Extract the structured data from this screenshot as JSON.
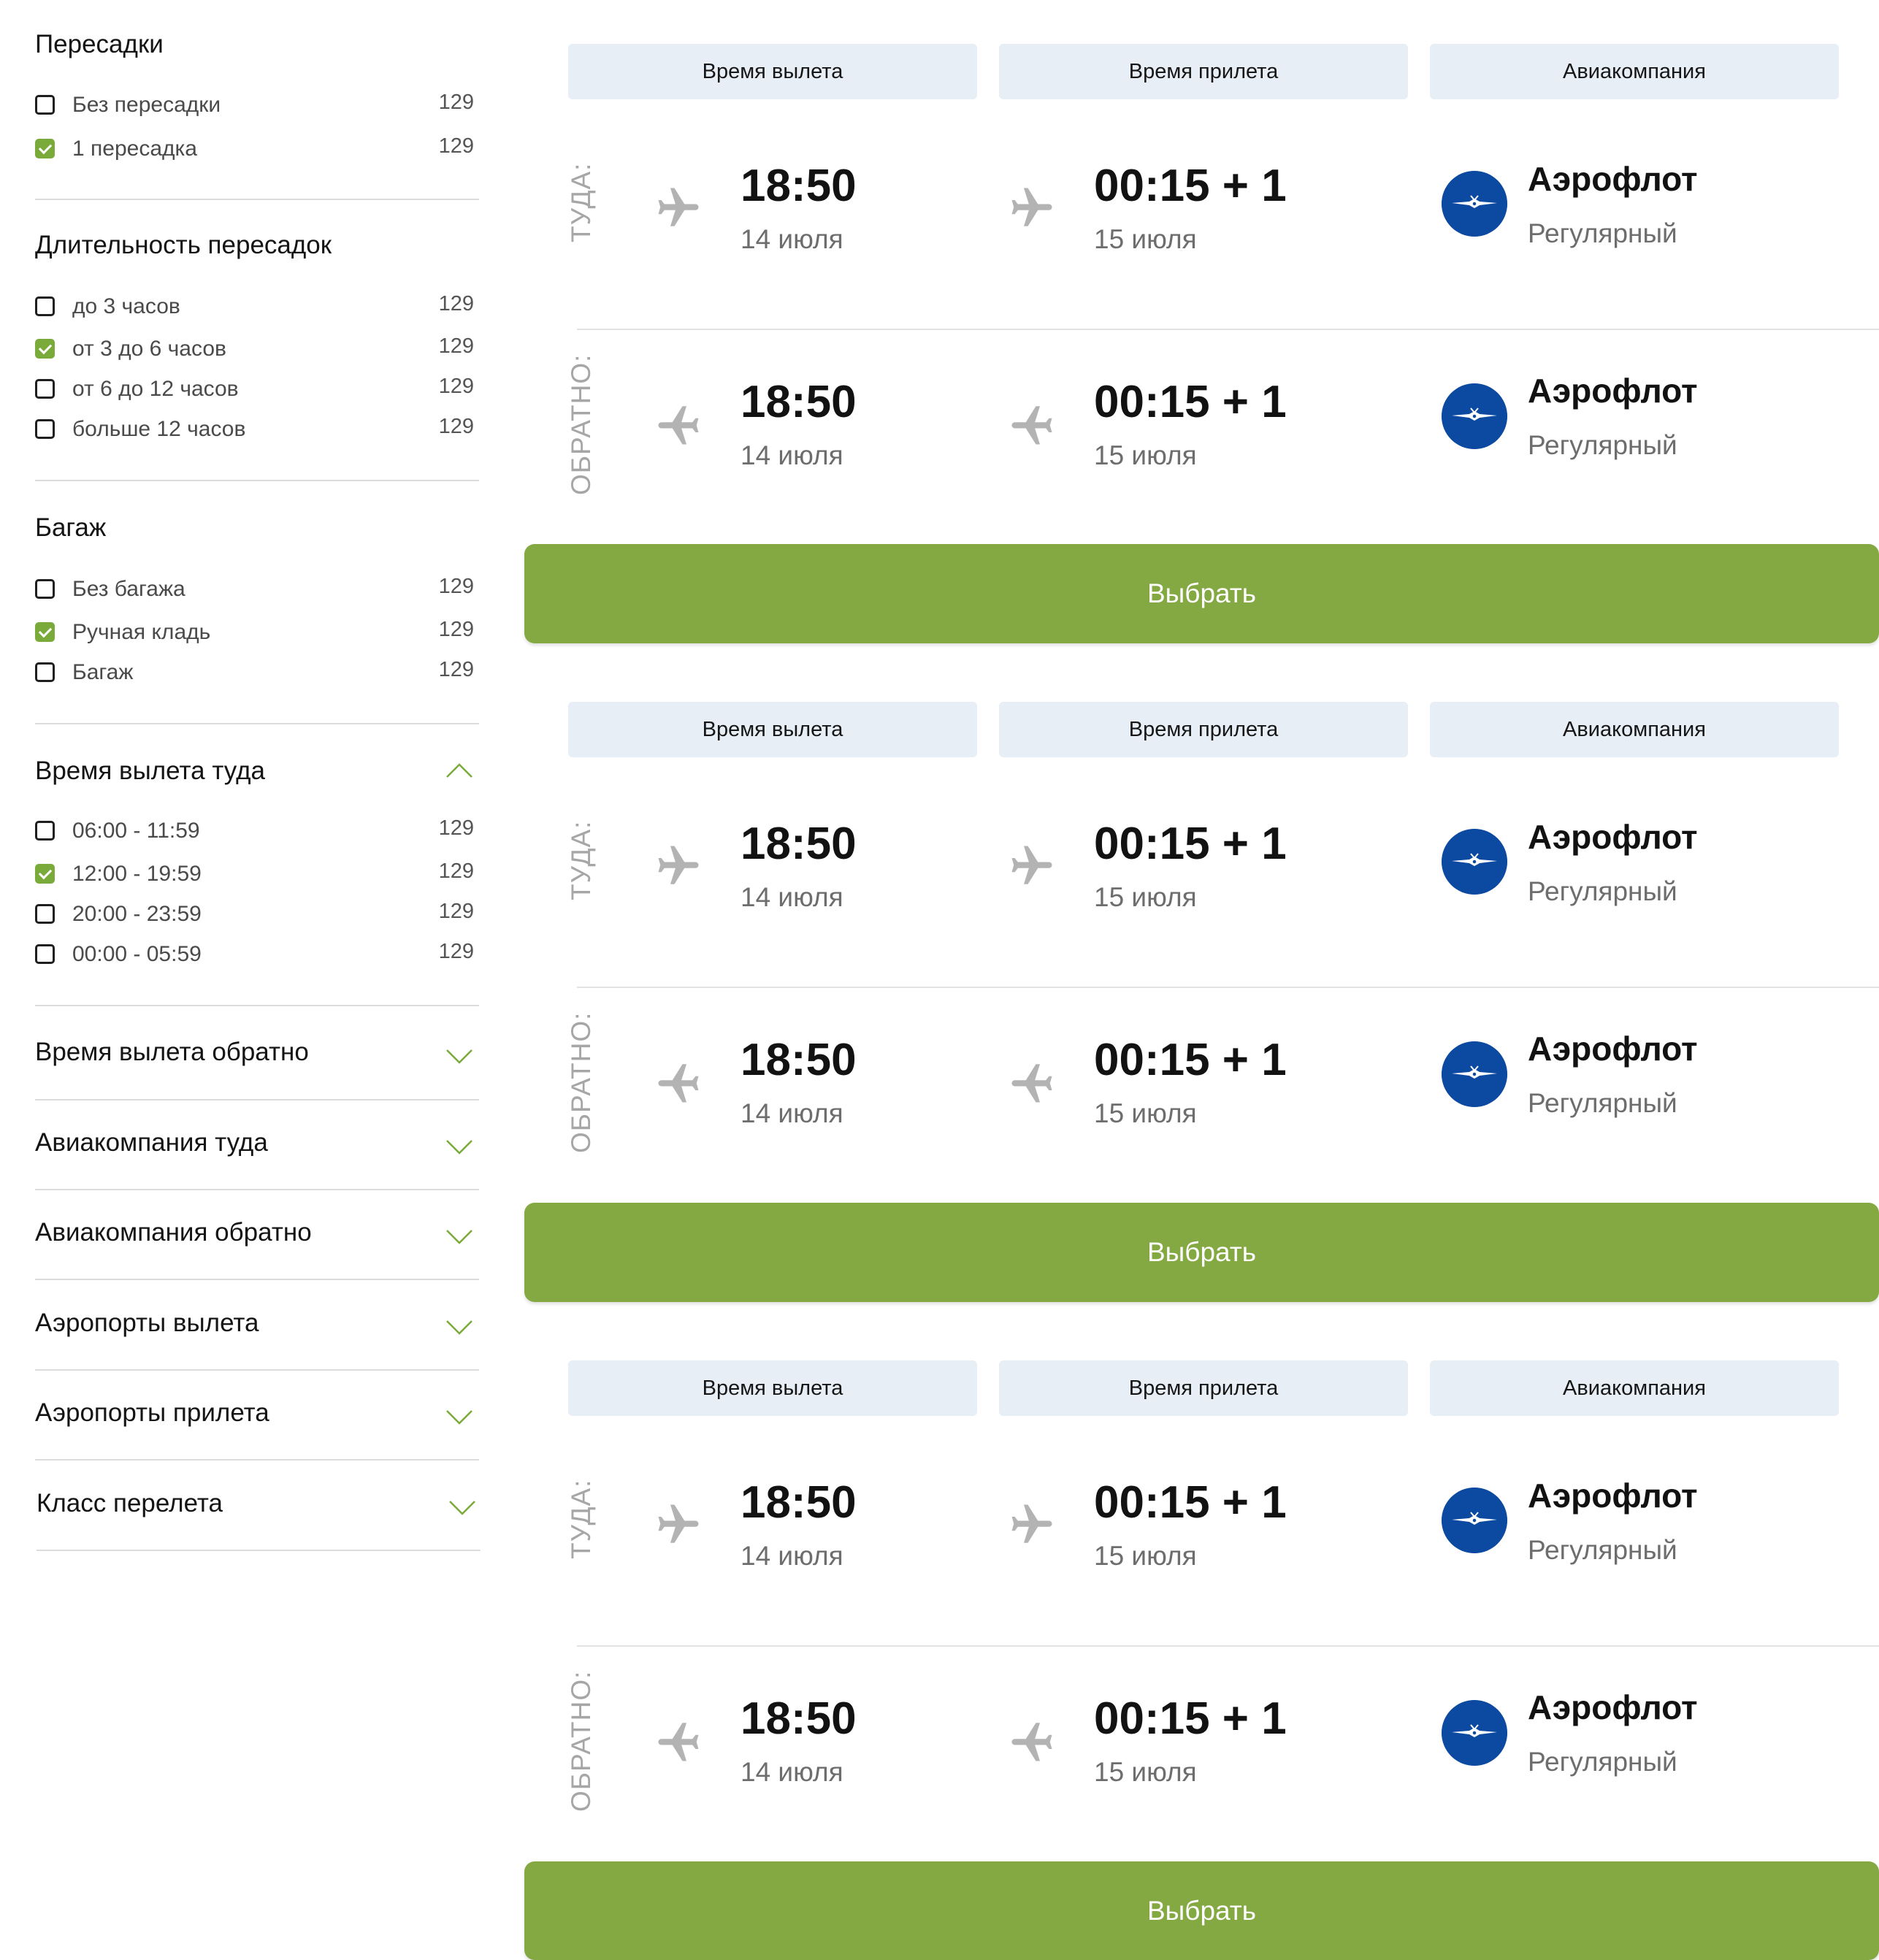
{
  "filters": {
    "transfers": {
      "title": "Пересадки",
      "options": [
        {
          "label": "Без пересадки",
          "count": "129",
          "checked": false
        },
        {
          "label": "1 пересадка",
          "count": "129",
          "checked": true
        }
      ]
    },
    "transfer_duration": {
      "title": "Длительность пересадок",
      "options": [
        {
          "label": "до 3 часов",
          "count": "129",
          "checked": false
        },
        {
          "label": "от 3 до 6 часов",
          "count": "129",
          "checked": true
        },
        {
          "label": "от 6 до 12 часов",
          "count": "129",
          "checked": false
        },
        {
          "label": "больше 12 часов",
          "count": "129",
          "checked": false
        }
      ]
    },
    "baggage": {
      "title": "Багаж",
      "options": [
        {
          "label": "Без багажа",
          "count": "129",
          "checked": false
        },
        {
          "label": "Ручная кладь",
          "count": "129",
          "checked": true
        },
        {
          "label": "Багаж",
          "count": "129",
          "checked": false
        }
      ]
    },
    "departure_time_there": {
      "title": "Время вылета туда",
      "expanded": true,
      "options": [
        {
          "label": "06:00 - 11:59",
          "count": "129",
          "checked": false
        },
        {
          "label": "12:00 - 19:59",
          "count": "129",
          "checked": true
        },
        {
          "label": "20:00 - 23:59",
          "count": "129",
          "checked": false
        },
        {
          "label": "00:00 - 05:59",
          "count": "129",
          "checked": false
        }
      ]
    },
    "collapsed": [
      {
        "title": "Время вылета обратно",
        "expanded": false
      },
      {
        "title": "Авиакомпания туда",
        "expanded": false
      },
      {
        "title": "Авиакомпания обратно",
        "expanded": false
      },
      {
        "title": "Аэропорты вылета",
        "expanded": false
      },
      {
        "title": "Аэропорты прилета",
        "expanded": false
      },
      {
        "title": "Класс перелета",
        "expanded": false
      }
    ]
  },
  "headers": {
    "departure": "Время вылета",
    "arrival": "Время прилета",
    "airline": "Авиакомпания"
  },
  "results": [
    {
      "segments": [
        {
          "direction": "ТУДА:",
          "dep_time": "18:50",
          "dep_date": "14 июля",
          "arr_time": "00:15 + 1",
          "arr_date": "15 июля",
          "airline": "Аэрофлот",
          "flight_type": "Регулярный"
        },
        {
          "direction": "ОБРАТНО:",
          "dep_time": "18:50",
          "dep_date": "14 июля",
          "arr_time": "00:15 + 1",
          "arr_date": "15 июля",
          "airline": "Аэрофлот",
          "flight_type": "Регулярный"
        }
      ],
      "select_label": "Выбрать"
    },
    {
      "segments": [
        {
          "direction": "ТУДА:",
          "dep_time": "18:50",
          "dep_date": "14 июля",
          "arr_time": "00:15 + 1",
          "arr_date": "15 июля",
          "airline": "Аэрофлот",
          "flight_type": "Регулярный"
        },
        {
          "direction": "ОБРАТНО:",
          "dep_time": "18:50",
          "dep_date": "14 июля",
          "arr_time": "00:15 + 1",
          "arr_date": "15 июля",
          "airline": "Аэрофлот",
          "flight_type": "Регулярный"
        }
      ],
      "select_label": "Выбрать"
    },
    {
      "segments": [
        {
          "direction": "ТУДА:",
          "dep_time": "18:50",
          "dep_date": "14 июля",
          "arr_time": "00:15 + 1",
          "arr_date": "15 июля",
          "airline": "Аэрофлот",
          "flight_type": "Регулярный"
        },
        {
          "direction": "ОБРАТНО:",
          "dep_time": "18:50",
          "dep_date": "14 июля",
          "arr_time": "00:15 + 1",
          "arr_date": "15 июля",
          "airline": "Аэрофлот",
          "flight_type": "Регулярный"
        }
      ],
      "select_label": "Выбрать"
    }
  ],
  "icons": {
    "plane": "airplane-icon",
    "airline_logo": "aeroflot-logo",
    "chevron_up": "chevron-up-icon",
    "chevron_down": "chevron-down-icon",
    "checkbox_checked": "checkbox-checked-icon"
  },
  "colors": {
    "accent_green": "#84a943",
    "checkbox_green": "#7aab3a",
    "header_bg": "#e8eef5",
    "airline_logo_blue": "#0c4aa2",
    "plane_gray": "#b3b3b3"
  }
}
